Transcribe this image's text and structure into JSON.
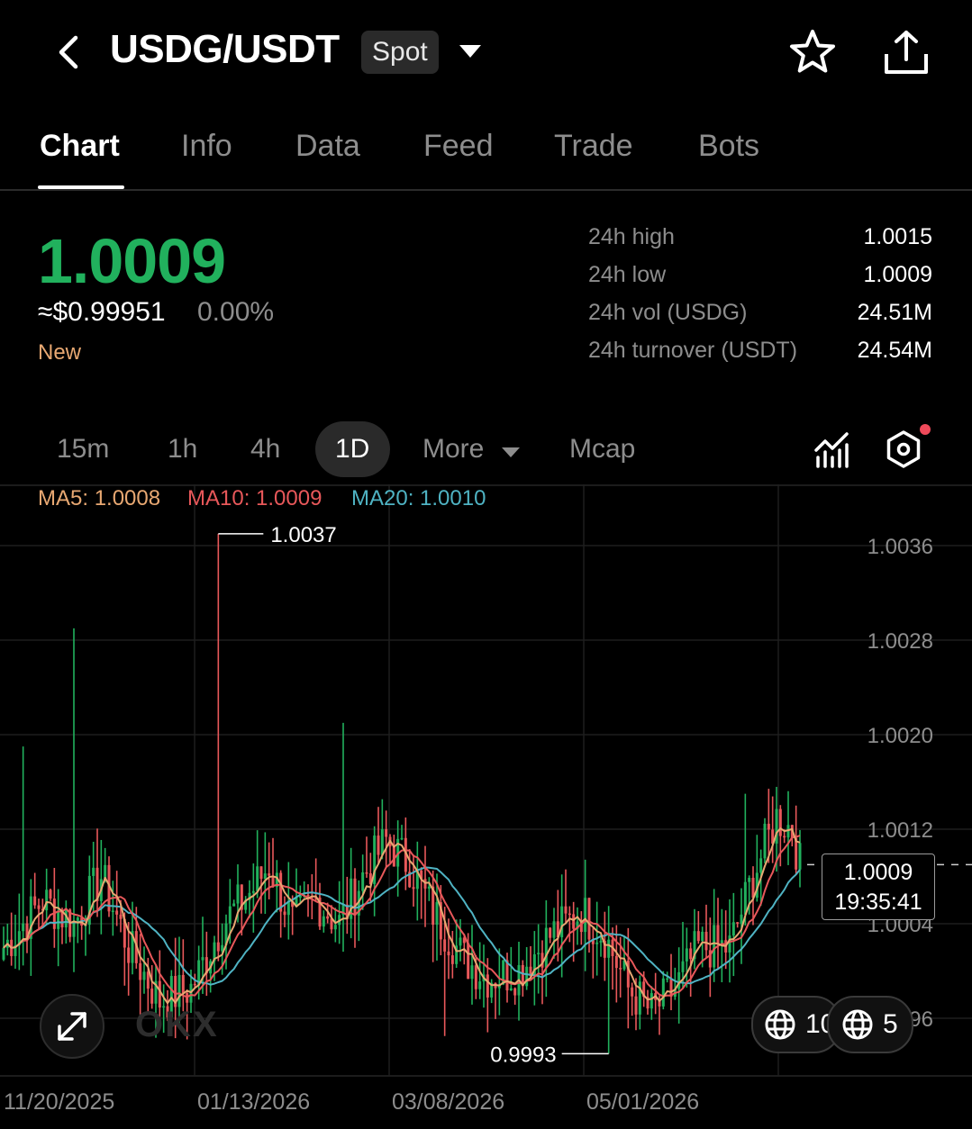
{
  "header": {
    "title": "USDG/USDT",
    "badge": "Spot"
  },
  "tabs": [
    "Chart",
    "Info",
    "Data",
    "Feed",
    "Trade",
    "Bots"
  ],
  "active_tab": "Chart",
  "price": {
    "last": "1.0009",
    "usd": "≈$0.99951",
    "change": "0.00%",
    "tag": "New",
    "color": "#21b15d"
  },
  "stats": [
    {
      "label": "24h high",
      "value": "1.0015"
    },
    {
      "label": "24h low",
      "value": "1.0009"
    },
    {
      "label": "24h vol (USDG)",
      "value": "24.51M"
    },
    {
      "label": "24h turnover (USDT)",
      "value": "24.54M"
    }
  ],
  "intervals": [
    "15m",
    "1h",
    "4h",
    "1D",
    "More",
    "Mcap"
  ],
  "active_interval": "1D",
  "ma_legend": {
    "ma5": {
      "label": "MA5: ",
      "value": "1.0008",
      "color": "#e8a872"
    },
    "ma10": {
      "label": "MA10: ",
      "value": "1.0009",
      "color": "#e8585a"
    },
    "ma20": {
      "label": "MA20: ",
      "value": "1.0010",
      "color": "#4fb3c3"
    }
  },
  "chart_data": {
    "type": "candlestick",
    "y_axis_ticks": [
      "1.0036",
      "1.0028",
      "1.0020",
      "1.0012",
      "1.0004",
      "0.9996"
    ],
    "y_axis_values": [
      1.0036,
      1.0028,
      1.002,
      1.0012,
      1.0004,
      0.9996
    ],
    "x_axis_ticks": [
      "11/20/2025",
      "01/13/2026",
      "03/08/2026",
      "05/01/2026"
    ],
    "max_label": "1.0037",
    "min_label": "0.9993",
    "current_price": "1.0009",
    "countdown": "19:35:41",
    "up_color": "#21b15d",
    "down_color": "#e8585a",
    "ma5_color": "#e8a872",
    "ma10_color": "#e8585a",
    "ma20_color": "#4fb3c3"
  },
  "widgets": {
    "pill_left_text": "10",
    "pill_right_text": "5",
    "watermark": "OKX"
  }
}
